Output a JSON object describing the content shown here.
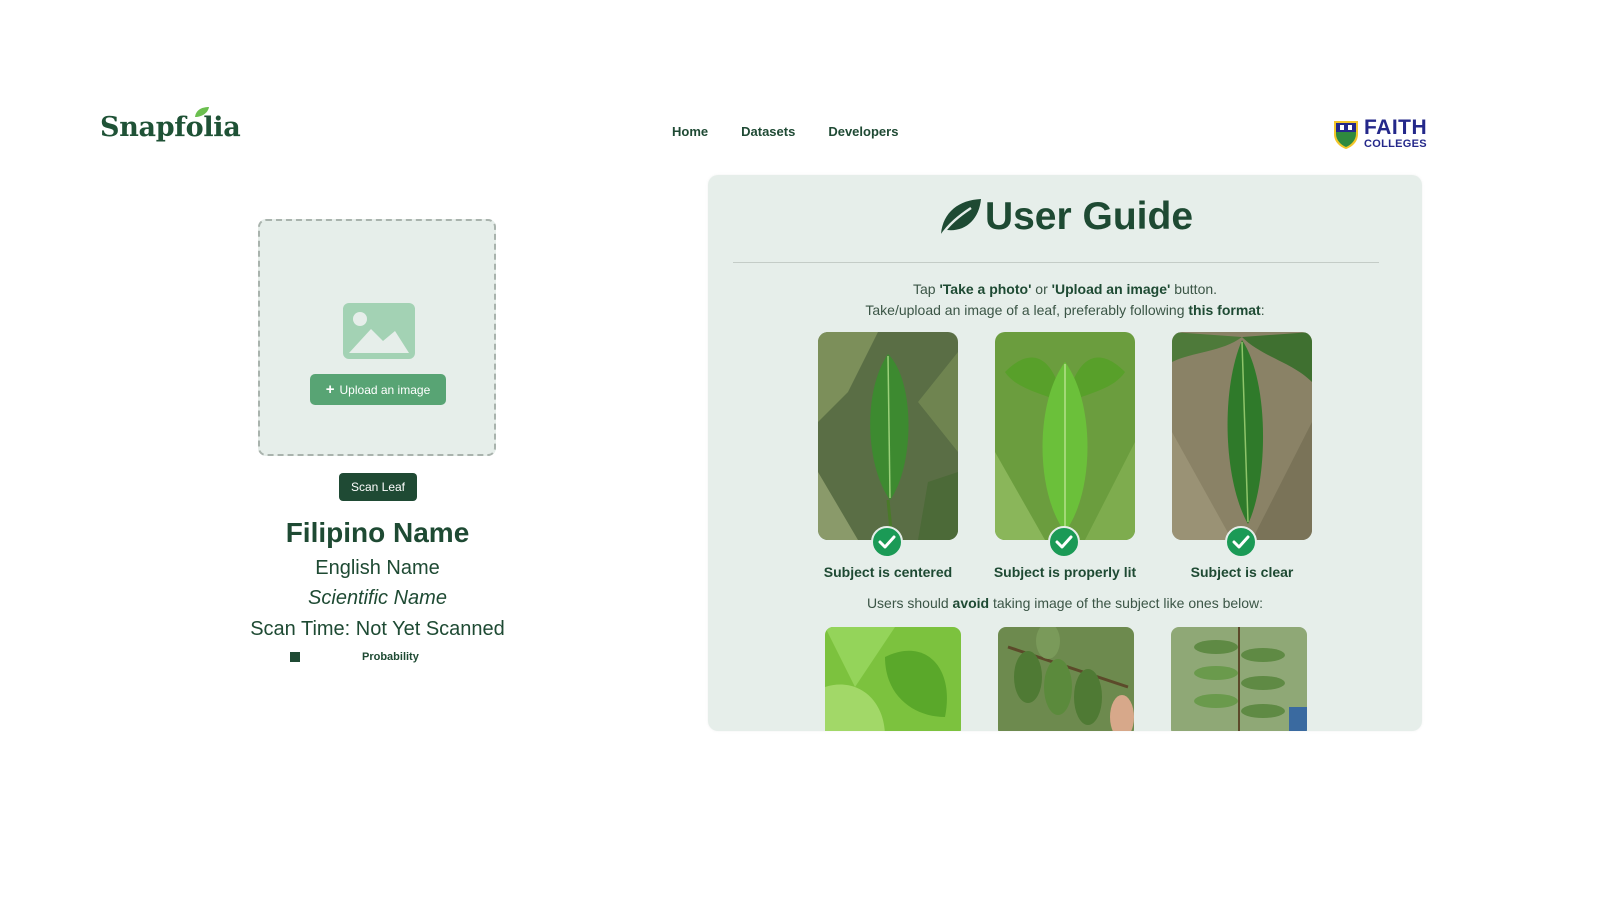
{
  "header": {
    "logo": "Snapfolia",
    "nav": [
      "Home",
      "Datasets",
      "Developers"
    ],
    "partner_logo": {
      "line1": "FAITH",
      "line2": "COLLEGES"
    }
  },
  "scanner": {
    "upload_label": "Upload an image",
    "scan_button": "Scan Leaf",
    "filipino_name": "Filipino Name",
    "english_name": "English Name",
    "scientific_name": "Scientific Name",
    "scan_time": "Scan Time: Not Yet Scanned",
    "probability_label": "Probability"
  },
  "guide": {
    "title": "User Guide",
    "line1": {
      "pre": "Tap ",
      "b1": "'Take a photo'",
      "mid": " or ",
      "b2": "'Upload an image'",
      "post": " button."
    },
    "line2": {
      "pre": "Take/upload an image of a leaf, preferably following ",
      "b": "this format",
      "post": ":"
    },
    "good_examples": [
      {
        "caption": "Subject is centered"
      },
      {
        "caption": "Subject is properly lit"
      },
      {
        "caption": "Subject is clear"
      }
    ],
    "avoid_line": {
      "pre": "Users should ",
      "b": "avoid",
      "post": " taking image of the subject like ones below:"
    }
  },
  "colors": {
    "primary_dark": "#1f4a34",
    "primary_light": "#58a474",
    "panel_bg": "#e6eeea",
    "check_green": "#1b9a56",
    "partner_blue": "#24288a"
  }
}
